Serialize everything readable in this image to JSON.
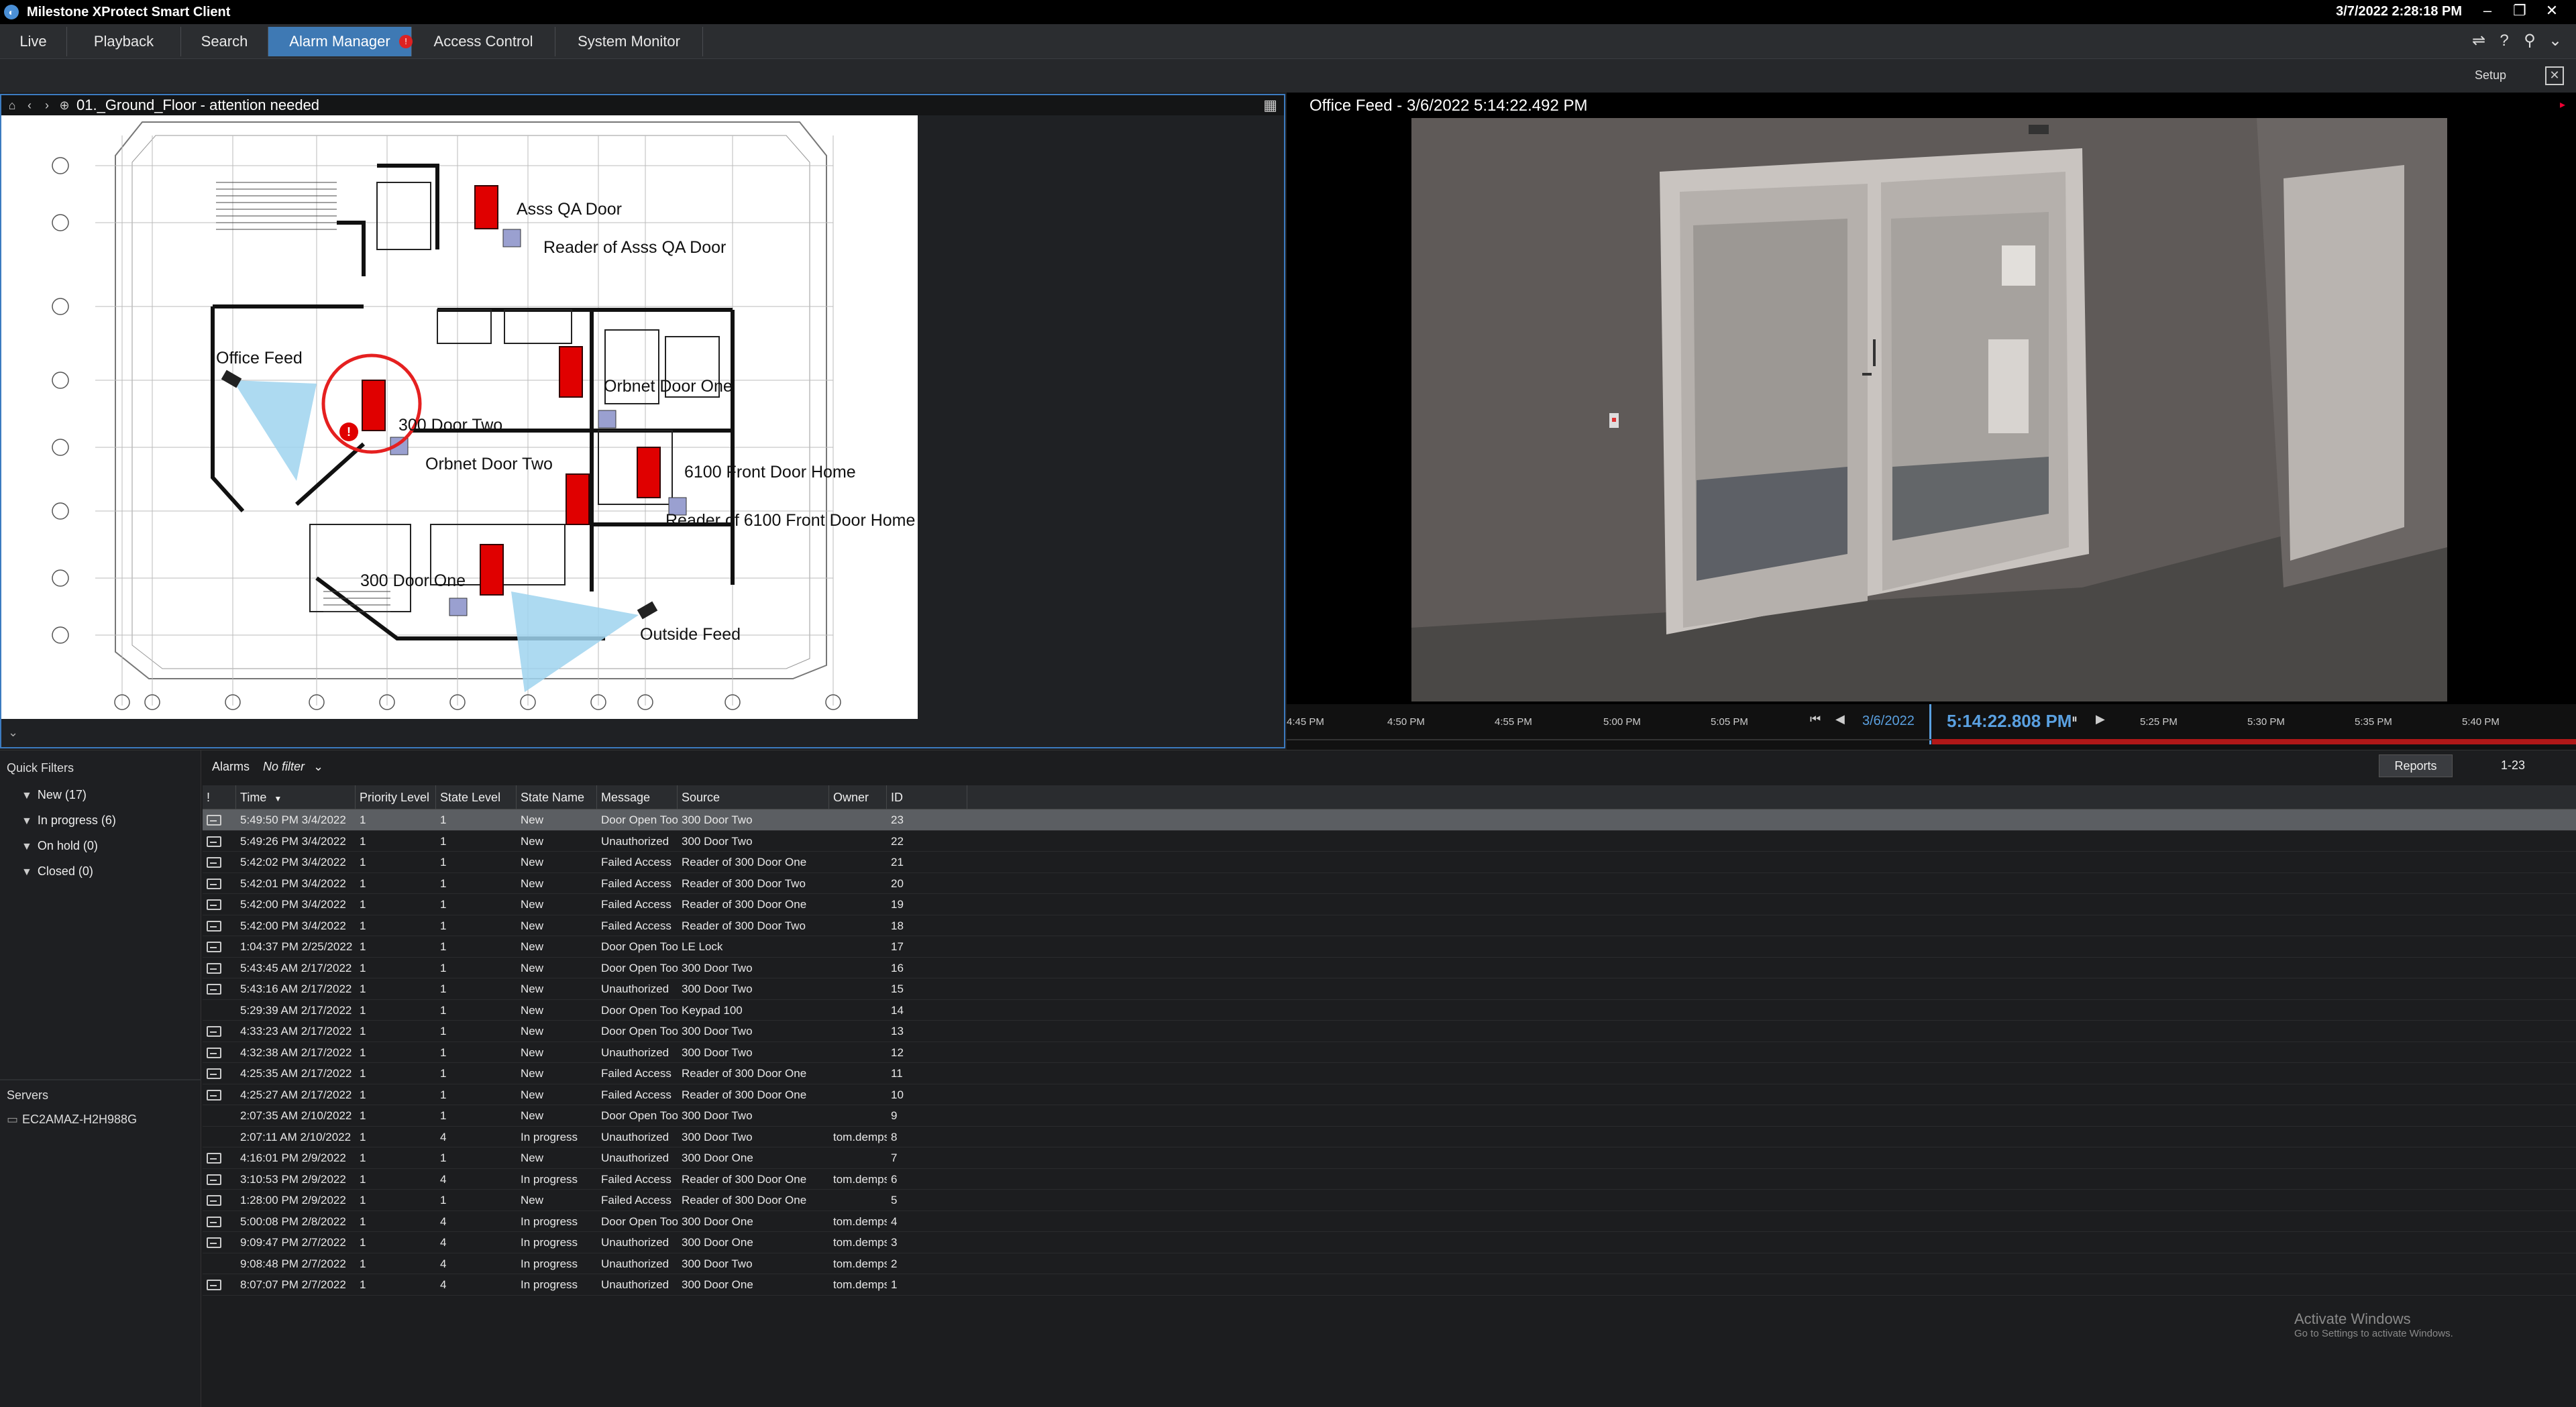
{
  "titlebar": {
    "app_title": "Milestone XProtect Smart Client",
    "datetime": "3/7/2022 2:28:18 PM",
    "minimize": "–",
    "restore": "❐",
    "close": "✕"
  },
  "nav": {
    "tabs": [
      {
        "label": "Live"
      },
      {
        "label": "Playback"
      },
      {
        "label": "Search"
      },
      {
        "label": "Alarm Manager",
        "active": true,
        "badge": "!"
      },
      {
        "label": "Access Control"
      },
      {
        "label": "System Monitor"
      }
    ]
  },
  "toolbar": {
    "setup_label": "Setup"
  },
  "map": {
    "breadcrumb": "01._Ground_Floor - attention needed",
    "labels": {
      "asss_qa_door": "Asss QA Door",
      "reader_asss_qa_door": "Reader of Asss QA Door",
      "office_feed": "Office Feed",
      "orbnet_door_one": "Orbnet Door One",
      "door_two_300": "300 Door Two",
      "orbnet_door_two": "Orbnet Door Two",
      "front_door_6100": "6100 Front Door Home",
      "reader_6100": "Reader of 6100 Front Door Home",
      "door_one_300": "300 Door One",
      "outside_feed": "Outside Feed"
    }
  },
  "video": {
    "title": "Office Feed - 3/6/2022 5:14:22.492 PM"
  },
  "timeline": {
    "ticks": [
      "4:45 PM",
      "4:50 PM",
      "4:55 PM",
      "5:00 PM",
      "5:05 PM",
      "5:25 PM",
      "5:30 PM",
      "5:35 PM",
      "5:40 PM"
    ],
    "date": "3/6/2022",
    "current_time": "5:14:22.808 PM"
  },
  "quick_filters": {
    "title": "Quick Filters",
    "items": [
      {
        "label": "New (17)"
      },
      {
        "label": "In progress (6)"
      },
      {
        "label": "On hold (0)"
      },
      {
        "label": "Closed (0)"
      }
    ]
  },
  "servers": {
    "title": "Servers",
    "items": [
      {
        "label": "EC2AMAZ-H2H988G"
      }
    ]
  },
  "alarms": {
    "label": "Alarms",
    "filter": "No filter",
    "reports_label": "Reports",
    "range": "1-23",
    "columns": [
      "!",
      "Time",
      "Priority Level",
      "State Level",
      "State Name",
      "Message",
      "Source",
      "Owner",
      "ID"
    ],
    "rows": [
      {
        "icon": true,
        "time": "5:49:50 PM 3/4/2022",
        "priority": "1",
        "state_level": "1",
        "state_name": "New",
        "message": "Door Open Too Long",
        "source": "300 Door Two",
        "owner": "",
        "id": "23"
      },
      {
        "icon": true,
        "time": "5:49:26 PM 3/4/2022",
        "priority": "1",
        "state_level": "1",
        "state_name": "New",
        "message": "Unauthorized",
        "source": "300 Door Two",
        "owner": "",
        "id": "22"
      },
      {
        "icon": true,
        "time": "5:42:02 PM 3/4/2022",
        "priority": "1",
        "state_level": "1",
        "state_name": "New",
        "message": "Failed Access",
        "source": "Reader of 300 Door One",
        "owner": "",
        "id": "21"
      },
      {
        "icon": true,
        "time": "5:42:01 PM 3/4/2022",
        "priority": "1",
        "state_level": "1",
        "state_name": "New",
        "message": "Failed Access",
        "source": "Reader of 300 Door Two",
        "owner": "",
        "id": "20"
      },
      {
        "icon": true,
        "time": "5:42:00 PM 3/4/2022",
        "priority": "1",
        "state_level": "1",
        "state_name": "New",
        "message": "Failed Access",
        "source": "Reader of 300 Door One",
        "owner": "",
        "id": "19"
      },
      {
        "icon": true,
        "time": "5:42:00 PM 3/4/2022",
        "priority": "1",
        "state_level": "1",
        "state_name": "New",
        "message": "Failed Access",
        "source": "Reader of 300 Door Two",
        "owner": "",
        "id": "18"
      },
      {
        "icon": true,
        "time": "1:04:37 PM 2/25/2022",
        "priority": "1",
        "state_level": "1",
        "state_name": "New",
        "message": "Door Open Too Long",
        "source": "LE Lock",
        "owner": "",
        "id": "17"
      },
      {
        "icon": true,
        "time": "5:43:45 AM 2/17/2022",
        "priority": "1",
        "state_level": "1",
        "state_name": "New",
        "message": "Door Open Too Long",
        "source": "300 Door Two",
        "owner": "",
        "id": "16"
      },
      {
        "icon": true,
        "time": "5:43:16 AM 2/17/2022",
        "priority": "1",
        "state_level": "1",
        "state_name": "New",
        "message": "Unauthorized",
        "source": "300 Door Two",
        "owner": "",
        "id": "15"
      },
      {
        "icon": false,
        "time": "5:29:39 AM 2/17/2022",
        "priority": "1",
        "state_level": "1",
        "state_name": "New",
        "message": "Door Open Too Long",
        "source": "Keypad 100",
        "owner": "",
        "id": "14"
      },
      {
        "icon": true,
        "time": "4:33:23 AM 2/17/2022",
        "priority": "1",
        "state_level": "1",
        "state_name": "New",
        "message": "Door Open Too Long",
        "source": "300 Door Two",
        "owner": "",
        "id": "13"
      },
      {
        "icon": true,
        "time": "4:32:38 AM 2/17/2022",
        "priority": "1",
        "state_level": "1",
        "state_name": "New",
        "message": "Unauthorized",
        "source": "300 Door Two",
        "owner": "",
        "id": "12"
      },
      {
        "icon": true,
        "time": "4:25:35 AM 2/17/2022",
        "priority": "1",
        "state_level": "1",
        "state_name": "New",
        "message": "Failed Access",
        "source": "Reader of 300 Door One",
        "owner": "",
        "id": "11"
      },
      {
        "icon": true,
        "time": "4:25:27 AM 2/17/2022",
        "priority": "1",
        "state_level": "1",
        "state_name": "New",
        "message": "Failed Access",
        "source": "Reader of 300 Door One",
        "owner": "",
        "id": "10"
      },
      {
        "icon": false,
        "time": "2:07:35 AM 2/10/2022",
        "priority": "1",
        "state_level": "1",
        "state_name": "New",
        "message": "Door Open Too Long",
        "source": "300 Door Two",
        "owner": "",
        "id": "9"
      },
      {
        "icon": false,
        "time": "2:07:11 AM 2/10/2022",
        "priority": "1",
        "state_level": "4",
        "state_name": "In progress",
        "message": "Unauthorized",
        "source": "300 Door Two",
        "owner": "tom.dempsey",
        "id": "8"
      },
      {
        "icon": true,
        "time": "4:16:01 PM 2/9/2022",
        "priority": "1",
        "state_level": "1",
        "state_name": "New",
        "message": "Unauthorized",
        "source": "300 Door One",
        "owner": "",
        "id": "7"
      },
      {
        "icon": true,
        "time": "3:10:53 PM 2/9/2022",
        "priority": "1",
        "state_level": "4",
        "state_name": "In progress",
        "message": "Failed Access",
        "source": "Reader of 300 Door One",
        "owner": "tom.dempsey",
        "id": "6"
      },
      {
        "icon": true,
        "time": "1:28:00 PM 2/9/2022",
        "priority": "1",
        "state_level": "1",
        "state_name": "New",
        "message": "Failed Access",
        "source": "Reader of 300 Door One",
        "owner": "",
        "id": "5"
      },
      {
        "icon": true,
        "time": "5:00:08 PM 2/8/2022",
        "priority": "1",
        "state_level": "4",
        "state_name": "In progress",
        "message": "Door Open Too Long",
        "source": "300 Door One",
        "owner": "tom.dempsey",
        "id": "4"
      },
      {
        "icon": true,
        "time": "9:09:47 PM 2/7/2022",
        "priority": "1",
        "state_level": "4",
        "state_name": "In progress",
        "message": "Unauthorized",
        "source": "300 Door One",
        "owner": "tom.dempsey",
        "id": "3"
      },
      {
        "icon": false,
        "time": "9:08:48 PM 2/7/2022",
        "priority": "1",
        "state_level": "4",
        "state_name": "In progress",
        "message": "Unauthorized",
        "source": "300 Door Two",
        "owner": "tom.dempsey",
        "id": "2"
      },
      {
        "icon": true,
        "time": "8:07:07 PM 2/7/2022",
        "priority": "1",
        "state_level": "4",
        "state_name": "In progress",
        "message": "Unauthorized",
        "source": "300 Door One",
        "owner": "tom.dempsey",
        "id": "1"
      }
    ]
  },
  "watermark": {
    "line1": "Activate Windows",
    "line2": "Go to Settings to activate Windows."
  },
  "colors": {
    "accent": "#3e79b4",
    "alarm_red": "#d22222",
    "timeline_blue": "#5aa0e0"
  }
}
